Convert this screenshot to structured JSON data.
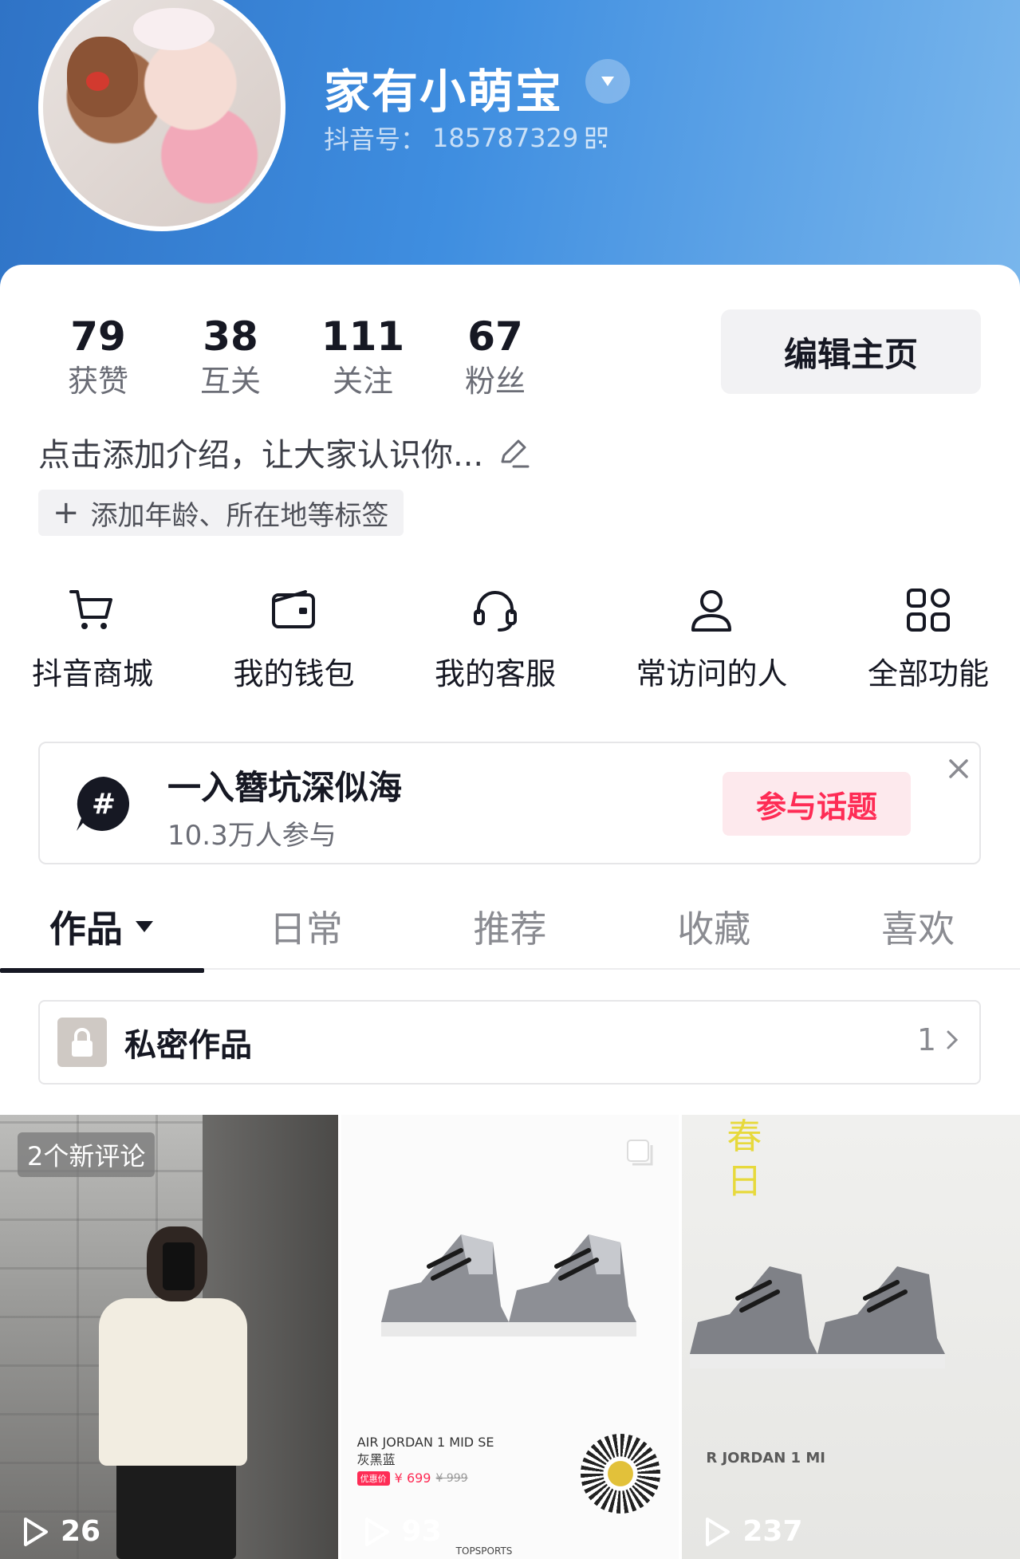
{
  "profile": {
    "username": "家有小萌宝",
    "douyin_id_label": "抖音号：",
    "douyin_id": "185787329"
  },
  "stats": [
    {
      "value": "79",
      "label": "获赞"
    },
    {
      "value": "38",
      "label": "互关"
    },
    {
      "value": "111",
      "label": "关注"
    },
    {
      "value": "67",
      "label": "粉丝"
    }
  ],
  "edit_button": "编辑主页",
  "intro_placeholder": "点击添加介绍，让大家认识你...",
  "tag_add": "添加年龄、所在地等标签",
  "features": [
    {
      "label": "抖音商城",
      "icon": "cart-icon"
    },
    {
      "label": "我的钱包",
      "icon": "wallet-icon"
    },
    {
      "label": "我的客服",
      "icon": "headset-icon"
    },
    {
      "label": "常访问的人",
      "icon": "person-icon"
    },
    {
      "label": "全部功能",
      "icon": "grid-icon"
    }
  ],
  "topic": {
    "title": "一入簪坑深似海",
    "participants": "10.3万人参与",
    "join_label": "参与话题"
  },
  "tabs": [
    {
      "label": "作品",
      "active": true
    },
    {
      "label": "日常",
      "active": false
    },
    {
      "label": "推荐",
      "active": false
    },
    {
      "label": "收藏",
      "active": false
    },
    {
      "label": "喜欢",
      "active": false
    }
  ],
  "private_works": {
    "label": "私密作品",
    "count": "1"
  },
  "videos": [
    {
      "badge": "2个新评论",
      "plays": "26"
    },
    {
      "plays": "93",
      "product_name": "AIR JORDAN 1 MID SE灰黑蓝",
      "product_tag": "优惠价",
      "product_price": "¥ 699",
      "product_old_price": "¥ 999",
      "brand": "TOPSPORTS"
    },
    {
      "plays": "237",
      "overlay_text": "春日",
      "product_name": "R JORDAN 1 MI"
    }
  ],
  "colors": {
    "accent": "#fe2c55",
    "header_gradient_start": "#2f73c6",
    "header_gradient_end": "#79b6ec",
    "text_primary": "#161823",
    "text_secondary": "#6b6d76"
  }
}
